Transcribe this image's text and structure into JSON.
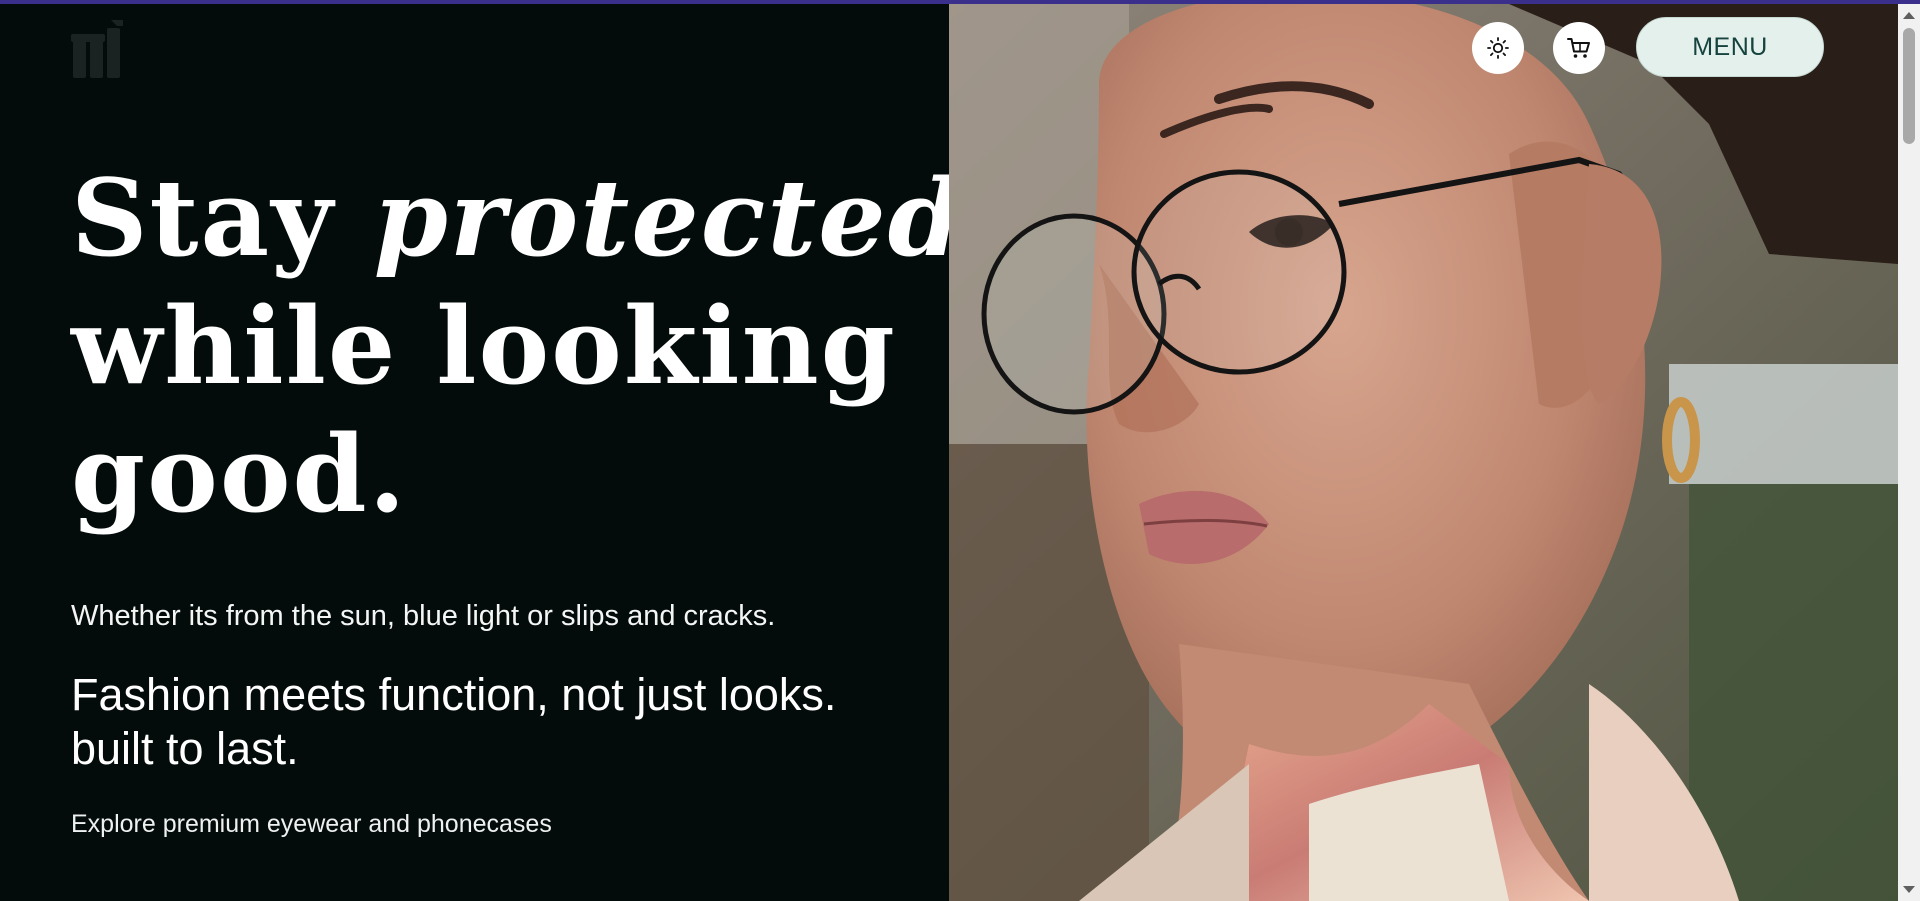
{
  "hero": {
    "title_line1_plain": "Stay ",
    "title_line1_emphasis": "protected",
    "title_line2": "while looking",
    "title_line3": "good.",
    "subtitle": "Whether its from the sun, blue light or slips and cracks.",
    "tagline_line1": "Fashion meets function, not just looks.",
    "tagline_line2": "built to last.",
    "explore_text": "Explore premium eyewear and phonecases"
  },
  "header": {
    "menu_label": "MENU",
    "theme_toggle_icon": "sun-icon",
    "cart_icon": "cart-icon"
  },
  "colors": {
    "page_background": "#040c0b",
    "menu_background": "#e4f0ec",
    "menu_text": "#16433e",
    "top_accent": "#3a2f8a"
  }
}
